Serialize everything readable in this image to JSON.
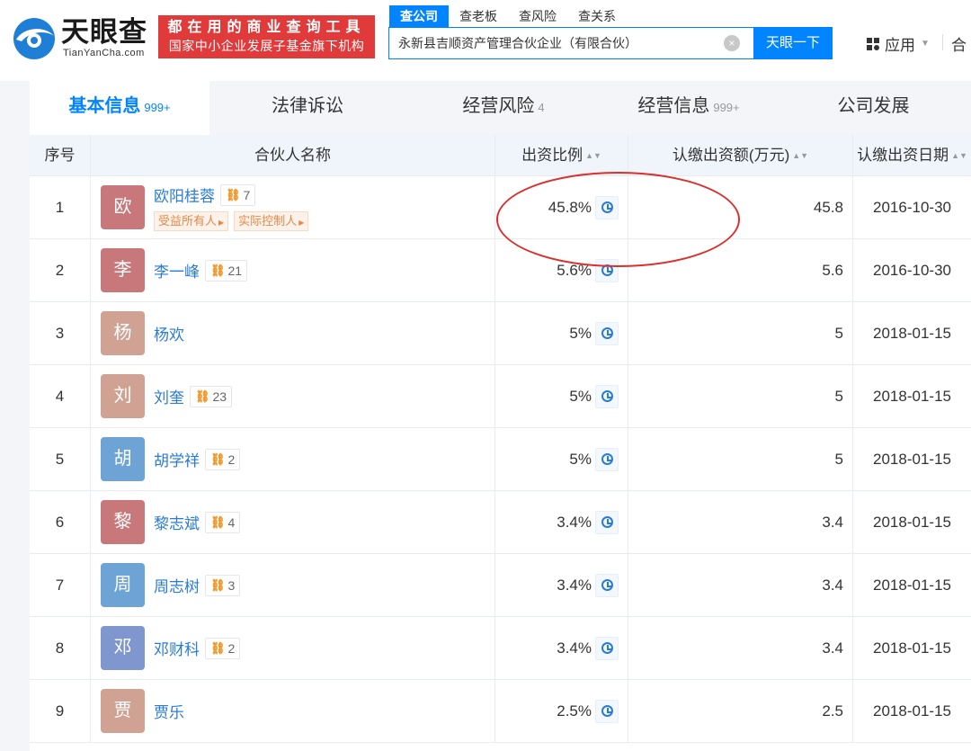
{
  "brand": {
    "name_cn": "天眼查",
    "name_en": "TianYanCha.com",
    "promo_line1": "都在用的商业查询工具",
    "promo_line2": "国家中小企业发展子基金旗下机构"
  },
  "search": {
    "tabs": [
      "查公司",
      "查老板",
      "查风险",
      "查关系"
    ],
    "active_tab": "查公司",
    "query": "永新县吉顺资产管理合伙企业（有限合伙）",
    "button_label": "天眼一下"
  },
  "topnav": {
    "apps_label": "应用",
    "partial_label": "合"
  },
  "tabs": [
    {
      "label": "基本信息",
      "count": "999+"
    },
    {
      "label": "法律诉讼",
      "count": ""
    },
    {
      "label": "经营风险",
      "count": "4"
    },
    {
      "label": "经营信息",
      "count": "999+"
    },
    {
      "label": "公司发展",
      "count": ""
    }
  ],
  "table": {
    "headers": {
      "index": "序号",
      "name": "合伙人名称",
      "ratio": "出资比例",
      "amount": "认缴出资额(万元)",
      "date": "认缴出资日期"
    },
    "rows": [
      {
        "index": "1",
        "avatar": "欧",
        "avatar_color": "#c8787a",
        "name": "欧阳桂蓉",
        "relations": "7",
        "tags": [
          "受益所有人",
          "实际控制人"
        ],
        "ratio": "45.8%",
        "amount": "45.8",
        "date": "2016-10-30"
      },
      {
        "index": "2",
        "avatar": "李",
        "avatar_color": "#c8787a",
        "name": "李一峰",
        "relations": "21",
        "tags": [],
        "ratio": "5.6%",
        "amount": "5.6",
        "date": "2016-10-30"
      },
      {
        "index": "3",
        "avatar": "杨",
        "avatar_color": "#cfa294",
        "name": "杨欢",
        "relations": "",
        "tags": [],
        "ratio": "5%",
        "amount": "5",
        "date": "2018-01-15"
      },
      {
        "index": "4",
        "avatar": "刘",
        "avatar_color": "#cfa294",
        "name": "刘奎",
        "relations": "23",
        "tags": [],
        "ratio": "5%",
        "amount": "5",
        "date": "2018-01-15"
      },
      {
        "index": "5",
        "avatar": "胡",
        "avatar_color": "#6ea3d6",
        "name": "胡学祥",
        "relations": "2",
        "tags": [],
        "ratio": "5%",
        "amount": "5",
        "date": "2018-01-15"
      },
      {
        "index": "6",
        "avatar": "黎",
        "avatar_color": "#c8787a",
        "name": "黎志斌",
        "relations": "4",
        "tags": [],
        "ratio": "3.4%",
        "amount": "3.4",
        "date": "2018-01-15"
      },
      {
        "index": "7",
        "avatar": "周",
        "avatar_color": "#6ea3d6",
        "name": "周志树",
        "relations": "3",
        "tags": [],
        "ratio": "3.4%",
        "amount": "3.4",
        "date": "2018-01-15"
      },
      {
        "index": "8",
        "avatar": "邓",
        "avatar_color": "#7f96cf",
        "name": "邓财科",
        "relations": "2",
        "tags": [],
        "ratio": "3.4%",
        "amount": "3.4",
        "date": "2018-01-15"
      },
      {
        "index": "9",
        "avatar": "贾",
        "avatar_color": "#cfa294",
        "name": "贾乐",
        "relations": "",
        "tags": [],
        "ratio": "2.5%",
        "amount": "2.5",
        "date": "2018-01-15"
      }
    ]
  },
  "colors": {
    "accent": "#0084ff",
    "link": "#2a7bd4",
    "promo_bg": "#e03a3a",
    "annotation": "#d9312e"
  }
}
